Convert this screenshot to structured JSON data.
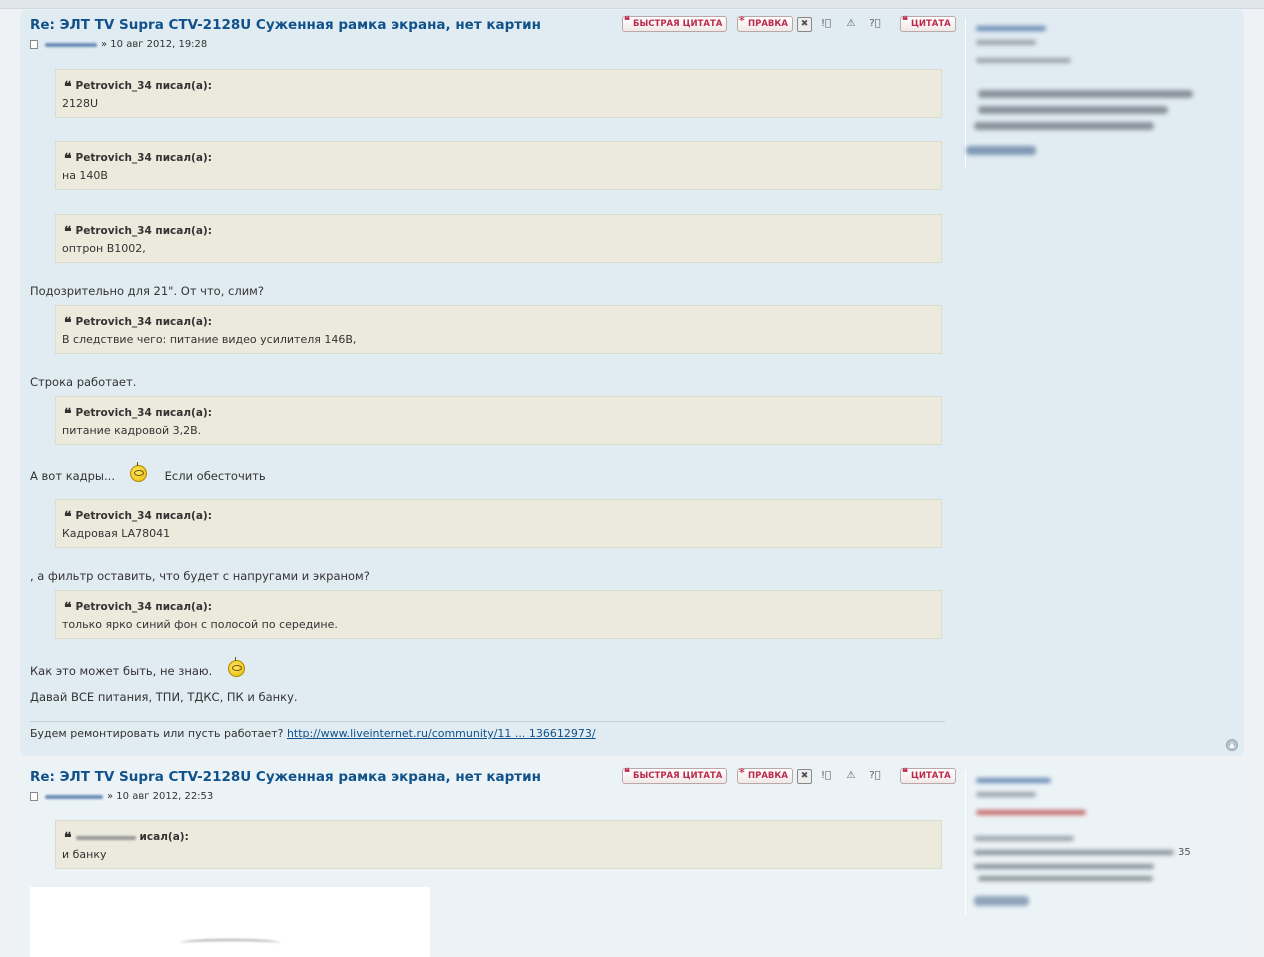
{
  "posts": [
    {
      "title": "Re: ЭЛТ TV Supra CTV-2128U Суженная рамка экрана, нет картин",
      "meta": "» 10 авг 2012, 19:28",
      "buttons": {
        "quick_quote": "БЫСТРАЯ ЦИТАТА",
        "edit": "ПРАВКА",
        "quote": "ЦИТАТА"
      },
      "quotes": [
        {
          "author": "Petrovich_34 писал(а):",
          "text": "2128U"
        },
        {
          "author": "Petrovich_34 писал(а):",
          "text": "на 140В"
        },
        {
          "author": "Petrovich_34 писал(а):",
          "text": "оптрон В1002,"
        },
        {
          "author": "Petrovich_34 писал(а):",
          "text": "В следствие чего: питание видео усилителя 146В,"
        },
        {
          "author": "Petrovich_34 писал(а):",
          "text": "питание кадровой 3,2В."
        },
        {
          "author": "Petrovich_34 писал(а):",
          "text": "Кадровая LA78041"
        },
        {
          "author": "Petrovich_34 писал(а):",
          "text": "только ярко синий фон с полосой по середине."
        }
      ],
      "paragraphs": {
        "p1": "Подозрительно для 21\". От что, слим?",
        "p2": "Строка работает.",
        "p3a": "А вот кадры...",
        "p3b": "Если обесточить",
        "p4": ", а фильтр оставить, что будет с напругами и экраном?",
        "p5": "Как это может быть, не знаю.",
        "p6": "Давай ВСЕ питания, ТПИ, ТДКС, ПК и банку."
      },
      "signature": {
        "text": "Будем ремонтировать или пусть работает?",
        "link": "http://www.liveinternet.ru/community/11 ... 136612973/"
      }
    },
    {
      "title": "Re: ЭЛТ TV Supra CTV-2128U Суженная рамка экрана, нет картин",
      "meta": "» 10 авг 2012, 22:53",
      "buttons": {
        "quick_quote": "БЫСТРАЯ ЦИТАТА",
        "edit": "ПРАВКА",
        "quote": "ЦИТАТА"
      },
      "quotes": [
        {
          "author": "исал(а):",
          "text": "и банку"
        }
      ],
      "profile_fragment": "35"
    }
  ],
  "icons": {
    "post": "post-icon",
    "delete": "delete-icon",
    "warn": "warn-icon",
    "report": "report-icon",
    "info": "info-icon",
    "top": "back-to-top-icon"
  },
  "colors": {
    "title": "#105289",
    "button_text": "#bc2a4d",
    "post_bg": "#e1ebf2",
    "quote_bg": "#ebeadd"
  }
}
